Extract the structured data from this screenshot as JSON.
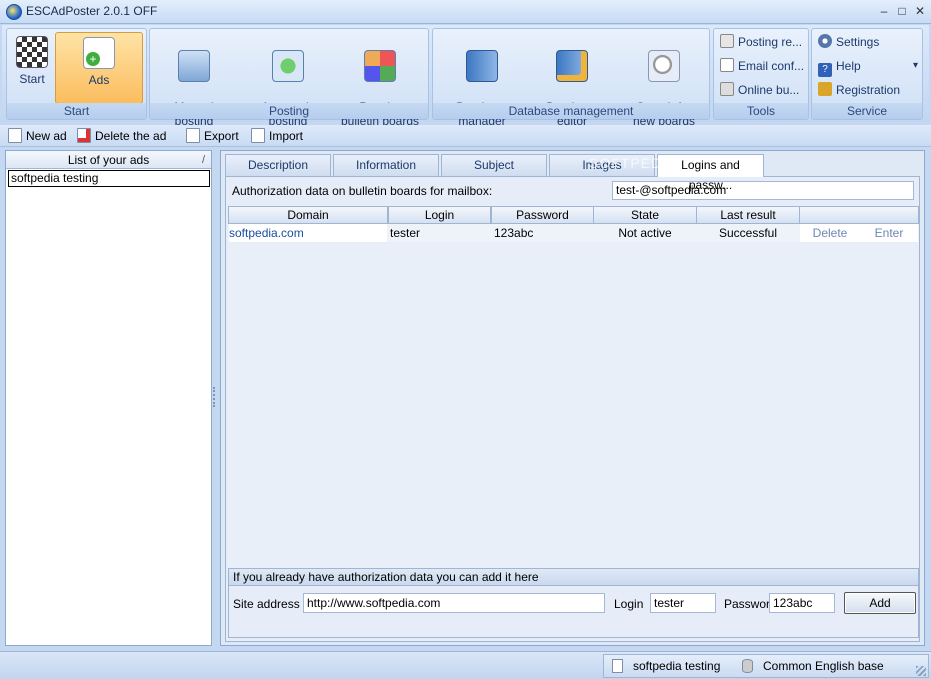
{
  "window": {
    "title": "ESCAdPoster 2.0.1 OFF",
    "min": "–",
    "max": "□",
    "close": "✕"
  },
  "ribbon": {
    "groups": [
      {
        "label": "Start",
        "buttons": [
          "Start",
          "Ads"
        ]
      },
      {
        "label": "Posting",
        "buttons": [
          "Manual\nposting",
          "Automatic\nposting",
          "Popular\nbulletin boards"
        ]
      },
      {
        "label": "Database management",
        "buttons": [
          "Database\nmanager",
          "Database\neditor",
          "Search for\nnew boards"
        ]
      },
      {
        "label": "Tools",
        "buttons": [
          "Posting re...",
          "Email conf...",
          "Online bu..."
        ]
      },
      {
        "label": "Service",
        "buttons": [
          "Settings",
          "Help",
          "Registration"
        ]
      }
    ],
    "help_arrow": "▾"
  },
  "toolbar": {
    "new_ad": "New ad",
    "delete_ad": "Delete the ad",
    "export": "Export",
    "import": "Import"
  },
  "ads_list": {
    "header": "List of your ads",
    "sort_glyph": "/",
    "items": [
      "softpedia testing"
    ]
  },
  "tabs": [
    "Description",
    "Information",
    "Subject",
    "Images",
    "Logins and passw..."
  ],
  "watermark": "SOFTPEDIA",
  "auth": {
    "label": "Authorization data on bulletin boards for mailbox:",
    "mailbox": "test-@softpedia.com"
  },
  "grid": {
    "columns": [
      "Domain",
      "Login",
      "Password",
      "State",
      "Last result",
      ""
    ],
    "rows": [
      {
        "domain": "softpedia.com",
        "login": "tester",
        "password": "123abc",
        "state": "Not active",
        "last_result": "Successful",
        "delete": "Delete",
        "enter": "Enter"
      }
    ]
  },
  "add_form": {
    "caption": "If you already have authorization data you can add it here",
    "site_label": "Site address",
    "site_value": "http://www.softpedia.com",
    "login_label": "Login",
    "login_value": "tester",
    "password_label": "Password",
    "password_value": "123abc",
    "add_label": "Add"
  },
  "status": {
    "ad_name": "softpedia testing",
    "base": "Common English base"
  },
  "colors": {
    "accent": "#fbbd5e",
    "ribbon": "#c2d6f1",
    "link": "#1a4fa0"
  }
}
